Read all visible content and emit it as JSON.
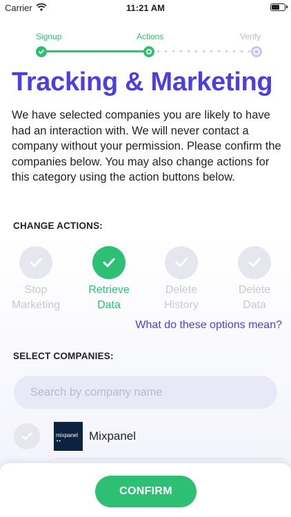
{
  "status_bar": {
    "carrier": "Carrier",
    "time": "11:21 AM"
  },
  "stepper": {
    "steps": [
      {
        "label": "Signup",
        "state": "done"
      },
      {
        "label": "Actions",
        "state": "current"
      },
      {
        "label": "Verify",
        "state": "todo"
      }
    ]
  },
  "page": {
    "title": "Tracking & Marketing",
    "intro": "We have selected companies you are likely to have had an interaction with. We will never contact a company without your permission. Please confirm the companies below. You may also change actions for this category using the action buttons below."
  },
  "actions_section": {
    "label": "CHANGE ACTIONS:",
    "actions": [
      {
        "line1": "Stop",
        "line2": "Marketing",
        "selected": false
      },
      {
        "line1": "Retrieve",
        "line2": "Data",
        "selected": true
      },
      {
        "line1": "Delete",
        "line2": "History",
        "selected": false
      },
      {
        "line1": "Delete",
        "line2": "Data",
        "selected": false
      }
    ],
    "options_link": "What do these options mean?"
  },
  "companies_section": {
    "label": "SELECT COMPANIES:",
    "search_placeholder": "Search by company name",
    "companies": [
      {
        "name": "Mixpanel",
        "logo_text": "mixpanel",
        "selected": false
      }
    ]
  },
  "footer": {
    "confirm_label": "CONFIRM"
  },
  "colors": {
    "accent": "#4c3ee0",
    "green": "#2dbf73",
    "inactive": "#e6e6ee"
  }
}
